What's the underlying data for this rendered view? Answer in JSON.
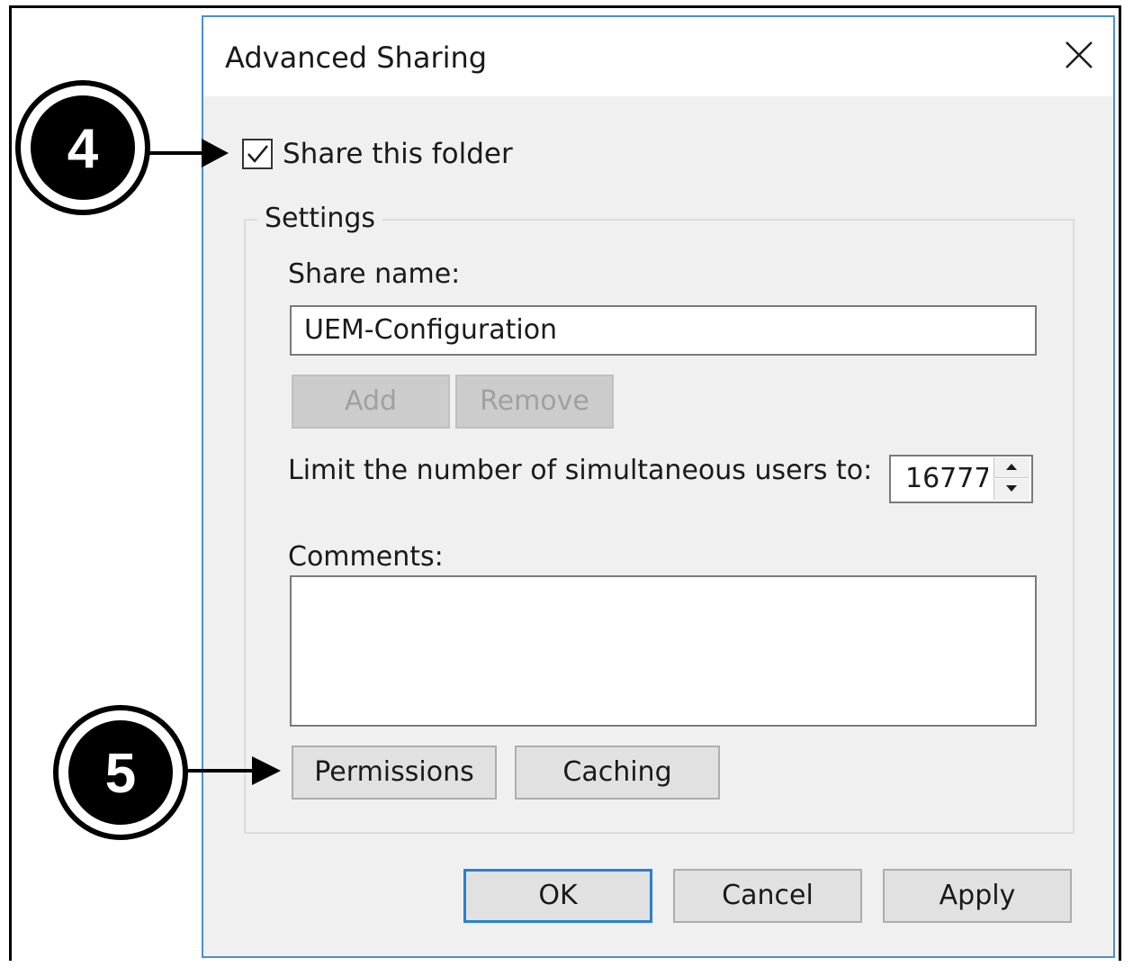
{
  "dialog": {
    "title": "Advanced Sharing",
    "close_icon": "close-icon",
    "share_checkbox": {
      "label": "Share this folder",
      "checked": true
    },
    "settings": {
      "group_label": "Settings",
      "share_name_label": "Share name:",
      "share_name_value": "UEM-Configuration",
      "add_label": "Add",
      "remove_label": "Remove",
      "limit_label": "Limit the number of simultaneous users to:",
      "limit_value": "16777",
      "comments_label": "Comments:",
      "comments_value": "",
      "permissions_label": "Permissions",
      "caching_label": "Caching"
    },
    "buttons": {
      "ok_label": "OK",
      "cancel_label": "Cancel",
      "apply_label": "Apply"
    }
  },
  "callouts": {
    "step_4": "4",
    "step_5": "5"
  },
  "colors": {
    "accent": "#2a7fd4",
    "dialog_border": "#4a8fd4",
    "dialog_bg": "#f0f0f0"
  }
}
